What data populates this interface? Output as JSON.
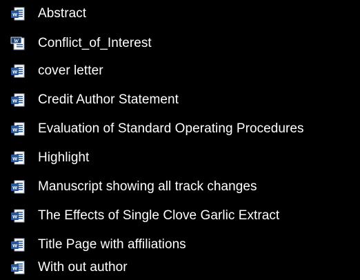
{
  "files": [
    {
      "name": "Abstract",
      "icon": "word-document-icon"
    },
    {
      "name": "Conflict_of_Interest",
      "icon": "word-legacy-document-icon"
    },
    {
      "name": "cover letter",
      "icon": "word-document-icon"
    },
    {
      "name": "Credit Author Statement",
      "icon": "word-document-icon"
    },
    {
      "name": "Evaluation of Standard Operating Procedures",
      "icon": "word-document-icon"
    },
    {
      "name": "Highlight",
      "icon": "word-document-icon"
    },
    {
      "name": "Manuscript showing all track changes",
      "icon": "word-document-icon"
    },
    {
      "name": "The Effects of Single Clove Garlic Extract",
      "icon": "word-document-icon"
    },
    {
      "name": "Title Page with affiliations",
      "icon": "word-document-icon"
    },
    {
      "name": "With out author",
      "icon": "word-document-icon"
    }
  ],
  "colors": {
    "background": "#000000",
    "text": "#ffffff",
    "word_blue": "#2b5797",
    "word_blue_dark": "#1e3f73",
    "page_white": "#ffffff"
  }
}
